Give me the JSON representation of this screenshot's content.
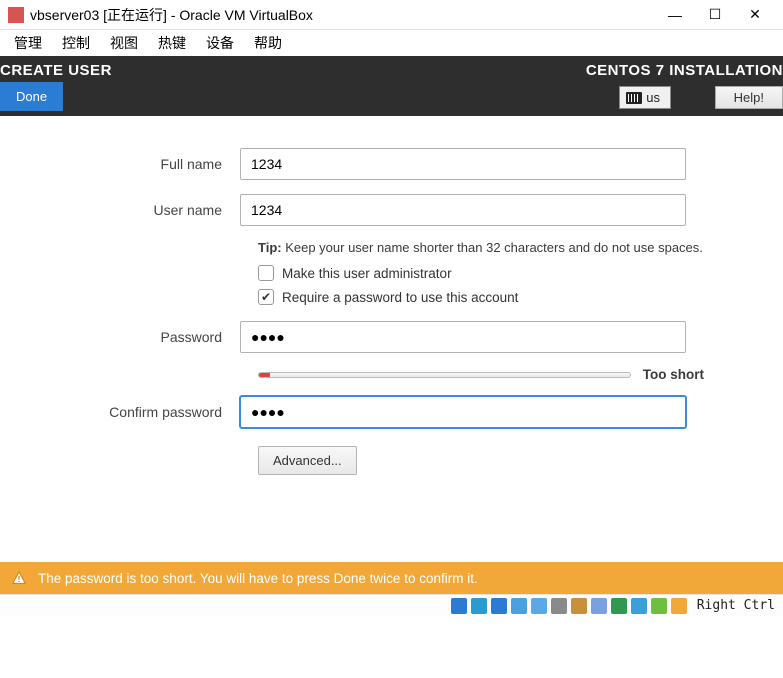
{
  "window": {
    "title": "vbserver03 [正在运行] - Oracle VM VirtualBox",
    "controls": {
      "minimize": "—",
      "maximize": "☐",
      "close": "✕"
    }
  },
  "menubar": [
    "管理",
    "控制",
    "视图",
    "热键",
    "设备",
    "帮助"
  ],
  "topbar": {
    "page_title": "CREATE USER",
    "install_title": "CENTOS 7 INSTALLATION",
    "done": "Done",
    "keyboard_layout": "us",
    "help": "Help!"
  },
  "form": {
    "full_name": {
      "label": "Full name",
      "value": "1234"
    },
    "user_name": {
      "label": "User name",
      "value": "1234"
    },
    "tip_prefix": "Tip:",
    "tip_text": " Keep your user name shorter than 32 characters and do not use spaces.",
    "admin_checkbox": {
      "checked": false,
      "label": "Make this user administrator"
    },
    "require_pw_checkbox": {
      "checked": true,
      "label": "Require a password to use this account"
    },
    "password": {
      "label": "Password",
      "value_mask": "●●●●"
    },
    "strength": {
      "text": "Too short",
      "fill_percent": 3
    },
    "confirm": {
      "label": "Confirm password",
      "value_mask": "●●●●"
    },
    "advanced": "Advanced..."
  },
  "warning": {
    "text": "The password is too short. You will have to press Done twice to confirm it."
  },
  "statusbar": {
    "host_key": "Right Ctrl",
    "icon_colors": [
      "#2a7bd1",
      "#2a9bd1",
      "#2a7bd1",
      "#4aa0e0",
      "#5aa8e6",
      "#8a8a8a",
      "#c98f3a",
      "#7aa0e0",
      "#2f9a4f",
      "#3aa0d8",
      "#6fbf3e",
      "#f2a838"
    ]
  }
}
